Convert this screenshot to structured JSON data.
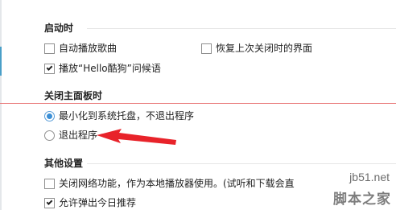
{
  "sections": {
    "startup": {
      "title": "启动时",
      "auto_play": {
        "label": "自动播放歌曲",
        "checked": false
      },
      "restore_ui": {
        "label": "恢复上次关闭时的界面",
        "checked": false
      },
      "greeting": {
        "label": "播放“Hello酷狗”问候语",
        "checked": true
      }
    },
    "close_panel": {
      "title": "关闭主面板时",
      "minimize_tray": {
        "label": "最小化到系统托盘，不退出程序",
        "selected": true
      },
      "exit_program": {
        "label": "退出程序",
        "selected": false
      }
    },
    "other": {
      "title": "其他设置",
      "disable_network": {
        "label": "关闭网络功能，作为本地播放器使用。(试听和下载会直",
        "checked": false
      },
      "daily_recommend": {
        "label": "允许弹出今日推荐",
        "checked": true
      }
    }
  },
  "annotation": {
    "arrow_color": "#e8232a"
  },
  "watermark": {
    "url": "jb51.net",
    "name": "脚本之家"
  },
  "colors": {
    "radio_selected": "#3b8fd6",
    "close_divider": "#e97a7a"
  }
}
